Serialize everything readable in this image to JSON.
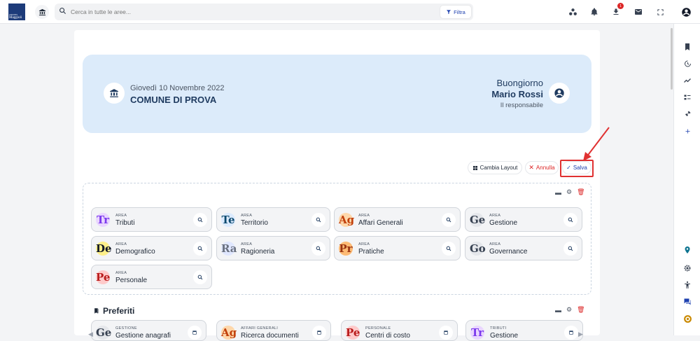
{
  "topbar": {
    "logo_text_top": "GRUPPO",
    "logo_text_main": "Maggioli",
    "search_placeholder": "Cerca in tutte le aree...",
    "filter_label": "Filtra",
    "download_badge": "1"
  },
  "hero": {
    "date": "Giovedì 10 Novembre 2022",
    "comune": "COMUNE DI PROVA",
    "greeting": "Buongiorno",
    "user_name": "Mario Rossi",
    "user_role": "Il responsabile"
  },
  "layout_buttons": {
    "change_layout": "Cambia Layout",
    "cancel": "Annulla",
    "save": "Salva"
  },
  "areas": [
    {
      "kicker": "AREA",
      "title": "Tributi",
      "glyph": "Tr",
      "color": "#7c3aed",
      "bg": "#e9d5ff"
    },
    {
      "kicker": "AREA",
      "title": "Territorio",
      "glyph": "Te",
      "color": "#0c4a6e",
      "bg": "#dbeafe"
    },
    {
      "kicker": "AREA",
      "title": "Affari Generali",
      "glyph": "Ag",
      "color": "#c2410c",
      "bg": "#fed7aa"
    },
    {
      "kicker": "AREA",
      "title": "Gestione",
      "glyph": "Ge",
      "color": "#374151",
      "bg": "#e5e7eb"
    },
    {
      "kicker": "AREA",
      "title": "Demografico",
      "glyph": "De",
      "color": "#111827",
      "bg": "#fef08a"
    },
    {
      "kicker": "AREA",
      "title": "Ragioneria",
      "glyph": "Ra",
      "color": "#6b7280",
      "bg": "#e0e7ff"
    },
    {
      "kicker": "AREA",
      "title": "Pratiche",
      "glyph": "Pr",
      "color": "#9a3412",
      "bg": "#fdba74"
    },
    {
      "kicker": "AREA",
      "title": "Governance",
      "glyph": "Go",
      "color": "#374151",
      "bg": "#e5e7eb"
    },
    {
      "kicker": "AREA",
      "title": "Personale",
      "glyph": "Pe",
      "color": "#b91c1c",
      "bg": "#fecaca"
    }
  ],
  "favorites": {
    "title": "Preferiti",
    "items": [
      {
        "kicker": "GESTIONE",
        "title": "Gestione anagrafi",
        "glyph": "Ge",
        "color": "#374151",
        "bg": "#e5e7eb"
      },
      {
        "kicker": "AFFARI GENERALI",
        "title": "Ricerca documenti",
        "glyph": "Ag",
        "color": "#c2410c",
        "bg": "#fed7aa"
      },
      {
        "kicker": "PERSONALE",
        "title": "Centri di costo",
        "glyph": "Pe",
        "color": "#b91c1c",
        "bg": "#fecaca"
      },
      {
        "kicker": "TRIBUTI",
        "title": "Gestione",
        "glyph": "Tr",
        "color": "#7c3aed",
        "bg": "#e9d5ff"
      }
    ]
  },
  "icons": {
    "bank": "bank-icon",
    "search": "search-icon",
    "filter": "filter-icon",
    "apps": "apps-icon",
    "bell": "bell-icon",
    "download": "download-icon",
    "mail": "mail-icon",
    "fullscreen": "fullscreen-icon",
    "account": "account-icon"
  },
  "colors": {
    "accent": "#1e40af",
    "danger": "#dc2626",
    "hero_bg": "#dcebfa",
    "highlight": "#e03131"
  }
}
